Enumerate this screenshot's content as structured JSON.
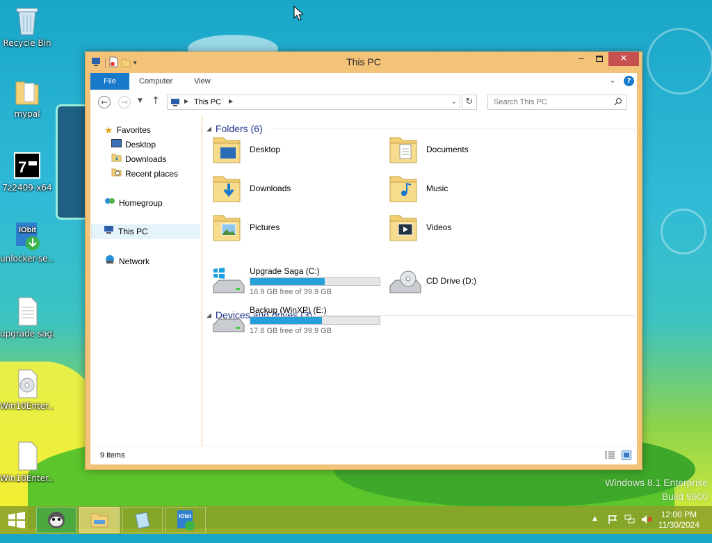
{
  "desktop": {
    "icons": [
      {
        "label": "Recycle Bin",
        "icon": "recycle-bin-icon"
      },
      {
        "label": "mypal",
        "icon": "folder-icon"
      },
      {
        "label": "7z2409-x64",
        "icon": "7zip-installer-icon"
      },
      {
        "label": "unlocker-se...",
        "icon": "iobit-unlocker-icon"
      },
      {
        "label": "upgrade saga",
        "icon": "text-file-icon"
      },
      {
        "label": "Win10Enter...",
        "icon": "disc-image-icon"
      },
      {
        "label": "Win10Enter...",
        "icon": "blank-file-icon"
      }
    ],
    "watermark": {
      "line1": "Windows 8.1 Enterprise",
      "line2": "Build 9600"
    }
  },
  "window": {
    "title": "This PC",
    "ribbon_tabs": [
      "File",
      "Computer",
      "View"
    ],
    "address": {
      "path": "This PC"
    },
    "search": {
      "placeholder": "Search This PC"
    },
    "nav": {
      "favorites": "Favorites",
      "favorites_items": [
        "Desktop",
        "Downloads",
        "Recent places"
      ],
      "homegroup": "Homegroup",
      "this_pc": "This PC",
      "network": "Network"
    },
    "folders_header": "Folders (6)",
    "folders": [
      {
        "label": "Desktop",
        "icon": "desktop-folder-icon"
      },
      {
        "label": "Documents",
        "icon": "documents-folder-icon"
      },
      {
        "label": "Downloads",
        "icon": "downloads-folder-icon"
      },
      {
        "label": "Music",
        "icon": "music-folder-icon"
      },
      {
        "label": "Pictures",
        "icon": "pictures-folder-icon"
      },
      {
        "label": "Videos",
        "icon": "videos-folder-icon"
      }
    ],
    "drives_header": "Devices and drives (3)",
    "drives": [
      {
        "name": "Upgrade Saga (C:)",
        "free": "16.9 GB free of 39.9 GB",
        "used_fraction": 0.576
      },
      {
        "name": "Backup (WinXP) (E:)",
        "free": "17.8 GB free of 39.9 GB",
        "used_fraction": 0.554
      },
      {
        "name": "CD Drive (D:)"
      }
    ],
    "status": {
      "items": "9 items"
    }
  },
  "taskbar": {
    "clock_time": "12:00 PM",
    "clock_date": "11/30/2024"
  },
  "colors": {
    "accent": "#1979ca",
    "titlebar": "#f4c37a",
    "close": "#c75050",
    "drive_fill": "#26a0da"
  }
}
